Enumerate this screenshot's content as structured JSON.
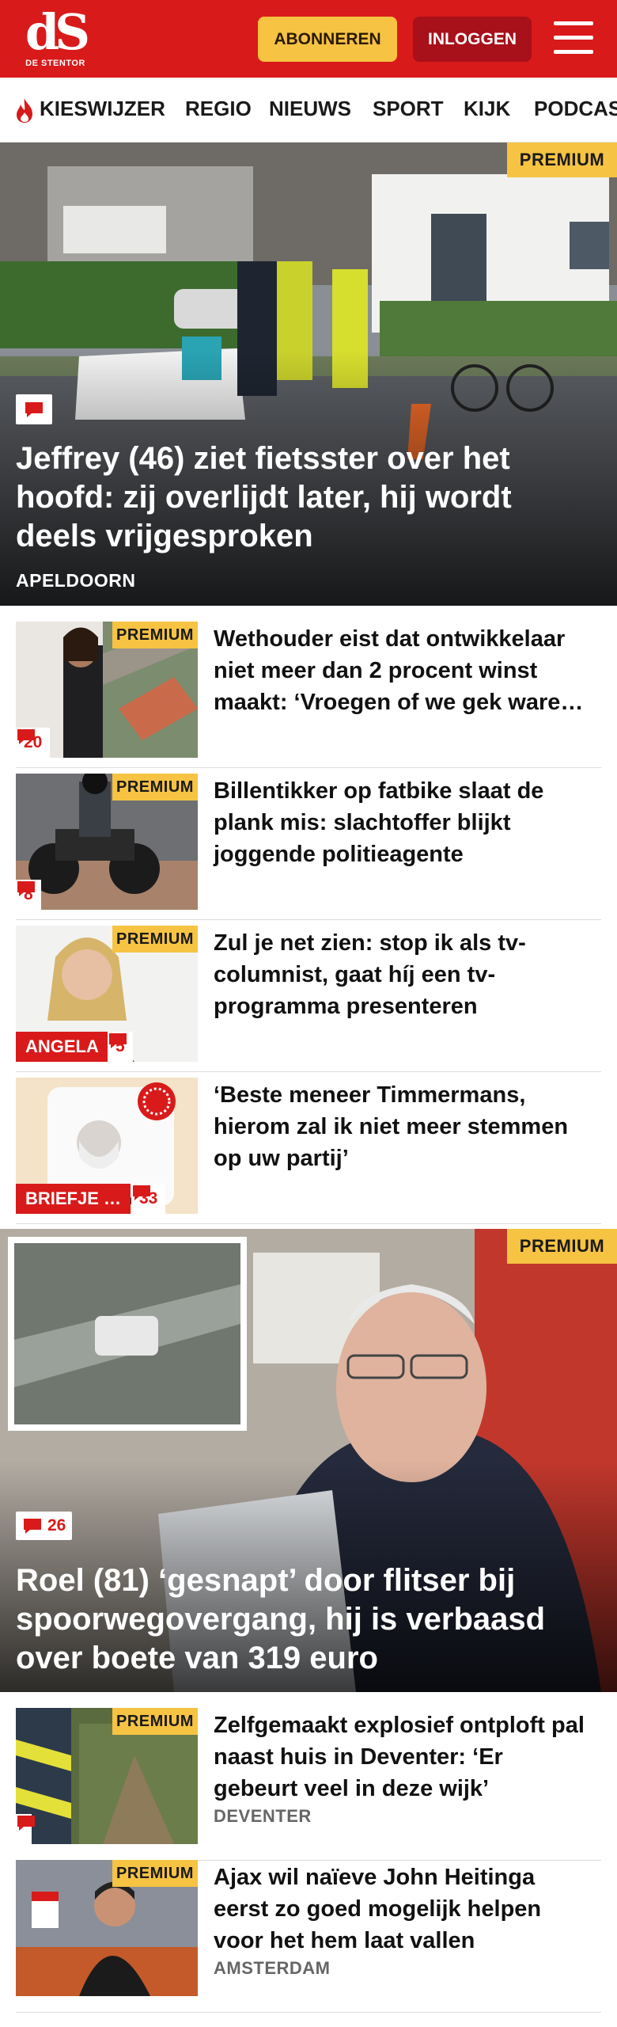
{
  "header": {
    "logo_text": "dS",
    "logo_sub": "DE STENTOR",
    "subscribe_label": "ABONNEREN",
    "login_label": "INLOGGEN",
    "brand_color": "#d91a1a"
  },
  "nav": {
    "items": [
      "KIESWIJZER",
      "REGIO",
      "NIEUWS",
      "SPORT",
      "KIJK",
      "PODCAST"
    ]
  },
  "hero": {
    "badge": "PREMIUM",
    "title": "Jeffrey (46) ziet fietsster over het hoofd: zij overlijdt later, hij wordt deels vrijgesproken",
    "location": "APELDOORN"
  },
  "articles": [
    {
      "badge": "PREMIUM",
      "title": "Wethouder eist dat ontwikkelaar niet meer dan 2 procent winst maakt: ‘Vroegen of we gek ware…",
      "comments": "20"
    },
    {
      "badge": "PREMIUM",
      "title": "Billentikker op fatbike slaat de plank mis: slachtoffer blijkt joggende politieagente",
      "comments": "8"
    },
    {
      "badge": "PREMIUM",
      "title": "Zul je net zien: stop ik als tv-columnist, gaat híj een tv-programma presenteren",
      "tag": "ANGELA",
      "comments": "5"
    },
    {
      "title": "‘Beste meneer Timmermans, hierom zal ik niet meer stemmen op uw partij’",
      "tag": "BRIEFJE …",
      "comments": "33"
    }
  ],
  "hero2": {
    "badge": "PREMIUM",
    "title": "Roel (81) ‘gesnapt’ door flitser bij spoorwegovergang, hij is verbaasd over boete van 319 euro",
    "comments": "26"
  },
  "articles2": [
    {
      "badge": "PREMIUM",
      "title": "Zelfgemaakt explosief ontploft pal naast huis in Deventer: ‘Er gebeurt veel in deze wijk’",
      "location": "DEVENTER"
    },
    {
      "badge": "PREMIUM",
      "title": "Ajax wil naïeve John Heitinga eerst zo goed mogelijk helpen voor het hem laat vallen",
      "location": "AMSTERDAM"
    }
  ],
  "colors": {
    "premium": "#f6c342",
    "brand": "#d91a1a",
    "login": "#a8101a"
  }
}
